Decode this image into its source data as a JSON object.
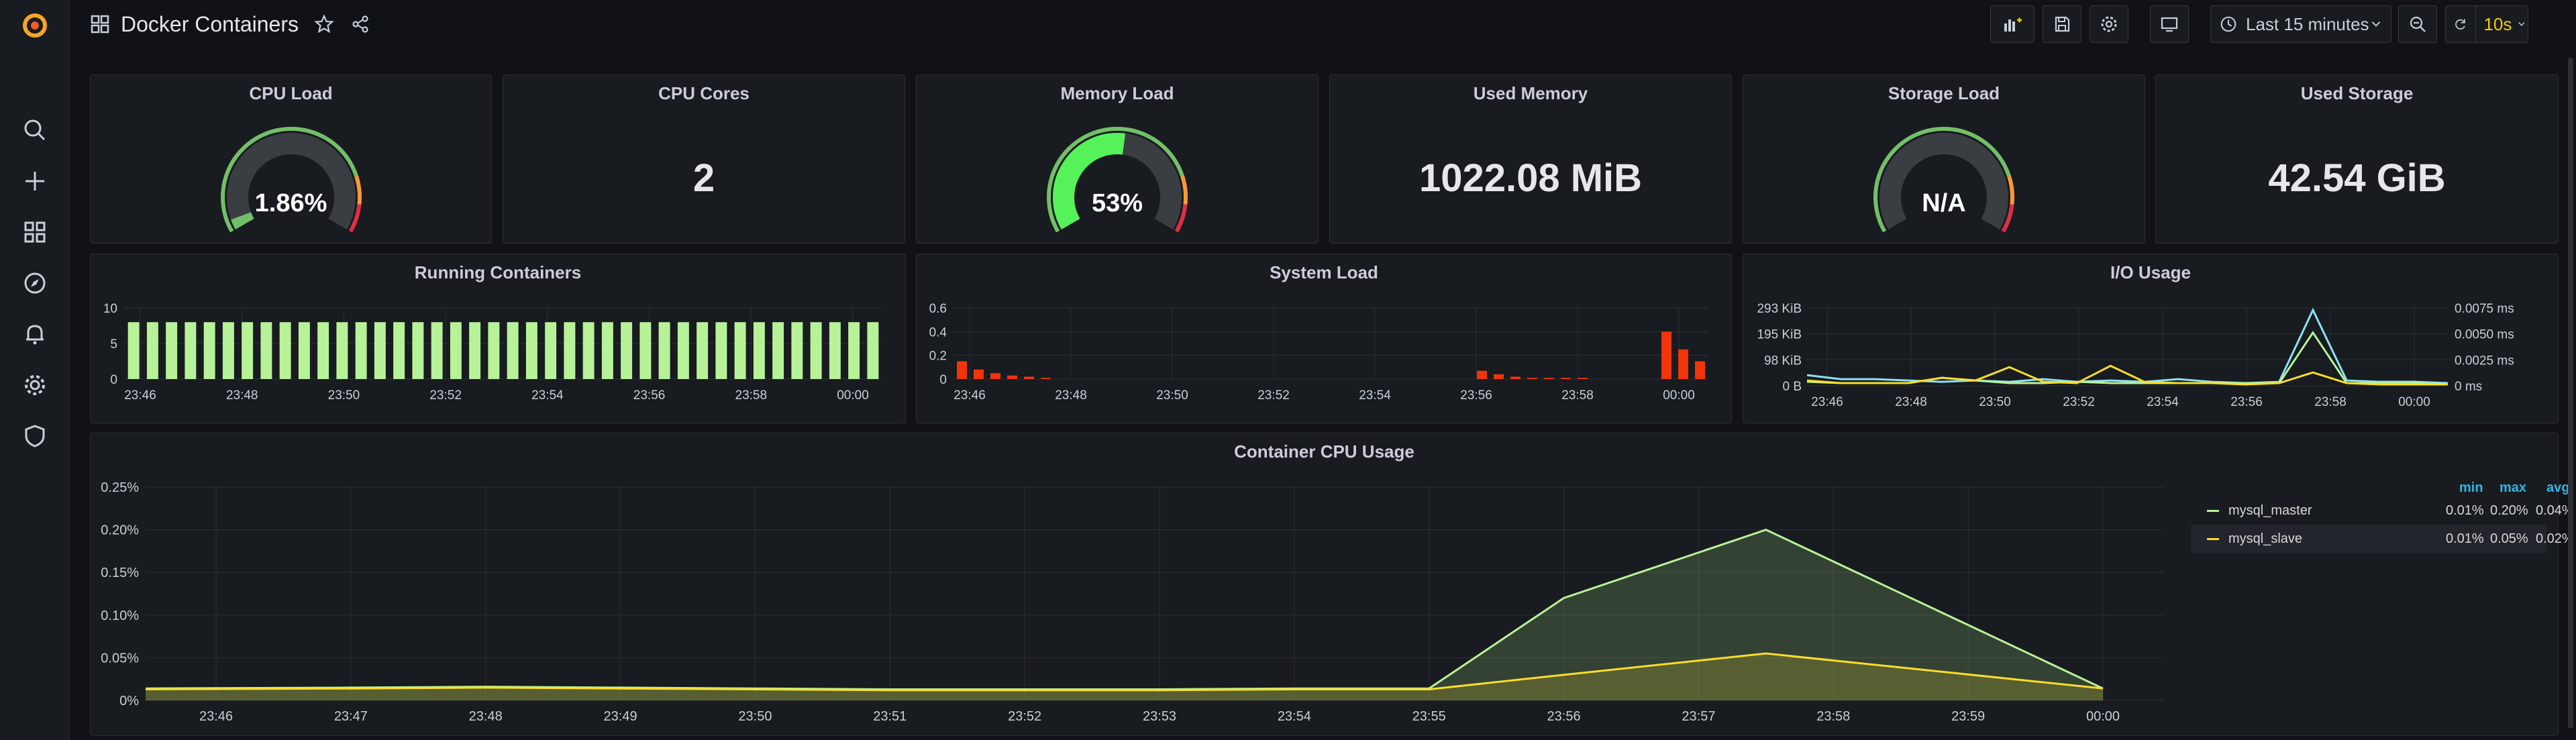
{
  "header": {
    "title": "Docker Containers",
    "time_range": "Last 15 minutes",
    "refresh_interval": "10s"
  },
  "icons": {
    "sidebar": [
      "grafana-logo-icon",
      "search-icon",
      "plus-icon",
      "dashboards-icon",
      "explore-icon",
      "alerting-icon",
      "settings-icon",
      "shield-icon"
    ],
    "toolbar": [
      "add-panel-icon",
      "save-icon",
      "settings-icon",
      "tv-mode-icon",
      "clock-icon",
      "chevron-down-icon",
      "zoom-out-icon",
      "refresh-icon",
      "chevron-down-icon"
    ]
  },
  "colors": {
    "accent": "#f2cc0c",
    "green": "#73bf69",
    "red": "#e02f44",
    "orange": "#ff780a",
    "light_green": "#b7f298",
    "yellow": "#fade2a",
    "cyan": "#8ae2f5"
  },
  "stats": {
    "cpu_load": {
      "title": "CPU Load",
      "value": "1.86%",
      "fraction": 0.0186
    },
    "cpu_cores": {
      "title": "CPU Cores",
      "value": "2"
    },
    "memory_load": {
      "title": "Memory Load",
      "value": "53%",
      "fraction": 0.53
    },
    "used_memory": {
      "title": "Used Memory",
      "value": "1022.08 MiB"
    },
    "storage_load": {
      "title": "Storage Load",
      "value": "N/A",
      "fraction": 0
    },
    "used_storage": {
      "title": "Used Storage",
      "value": "42.54 GiB"
    }
  },
  "chart_data": [
    {
      "id": "running_containers",
      "type": "bar",
      "title": "Running Containers",
      "ylim": [
        0,
        10
      ],
      "yticks": [
        "10",
        "5",
        "0"
      ],
      "xticks": [
        "23:46",
        "23:48",
        "23:50",
        "23:52",
        "23:54",
        "23:56",
        "23:58",
        "00:00"
      ],
      "values": [
        8,
        8,
        8,
        8,
        8,
        8,
        8,
        8,
        8,
        8,
        8,
        8,
        8,
        8,
        8,
        8,
        8,
        8,
        8,
        8,
        8,
        8,
        8,
        8,
        8,
        8,
        8,
        8,
        8,
        8,
        8,
        8,
        8,
        8,
        8,
        8,
        8,
        8,
        8,
        8
      ]
    },
    {
      "id": "system_load",
      "type": "bar",
      "title": "System Load",
      "ylim": [
        0,
        0.6
      ],
      "yticks": [
        "0.6",
        "0.4",
        "0.2",
        "0"
      ],
      "xticks": [
        "23:46",
        "23:48",
        "23:50",
        "23:52",
        "23:54",
        "23:56",
        "23:58",
        "00:00"
      ],
      "values": [
        0.15,
        0.08,
        0.05,
        0.03,
        0.02,
        0.01,
        0,
        0,
        0,
        0,
        0,
        0,
        0,
        0,
        0,
        0,
        0,
        0,
        0,
        0,
        0,
        0,
        0,
        0,
        0,
        0,
        0,
        0,
        0,
        0,
        0,
        0.07,
        0.04,
        0.02,
        0.01,
        0.01,
        0.01,
        0.01,
        0,
        0,
        0,
        0,
        0.4,
        0.25,
        0.15
      ]
    },
    {
      "id": "io_usage",
      "type": "line",
      "title": "I/O Usage",
      "yticks_left": [
        "293 KiB",
        "195 KiB",
        "98 KiB",
        "0 B"
      ],
      "yticks_right": [
        "0.0075 ms",
        "0.0050 ms",
        "0.0025 ms",
        "0 ms"
      ],
      "xticks": [
        "23:46",
        "23:48",
        "23:50",
        "23:52",
        "23:54",
        "23:56",
        "23:58",
        "00:00"
      ],
      "series": [
        {
          "color": "#8ae2f5",
          "values": [
            40,
            25,
            25,
            20,
            15,
            20,
            15,
            25,
            15,
            20,
            15,
            25,
            15,
            10,
            15,
            285,
            20,
            15,
            15,
            10
          ]
        },
        {
          "color": "#b7f298",
          "values": [
            15,
            10,
            10,
            10,
            30,
            20,
            10,
            10,
            15,
            10,
            10,
            10,
            10,
            10,
            10,
            200,
            10,
            10,
            10,
            5
          ]
        },
        {
          "color": "#fade2a",
          "values": [
            20,
            10,
            10,
            10,
            30,
            20,
            70,
            15,
            10,
            75,
            15,
            10,
            10,
            5,
            10,
            50,
            10,
            5,
            5,
            5
          ]
        }
      ]
    },
    {
      "id": "container_cpu_usage",
      "type": "area",
      "title": "Container CPU Usage",
      "ylim": [
        0,
        0.25
      ],
      "yticks": [
        "0.25%",
        "0.20%",
        "0.15%",
        "0.10%",
        "0.05%",
        "0%"
      ],
      "xticks": [
        "23:46",
        "23:47",
        "23:48",
        "23:49",
        "23:50",
        "23:51",
        "23:52",
        "23:53",
        "23:54",
        "23:55",
        "23:56",
        "23:57",
        "23:58",
        "23:59",
        "00:00"
      ],
      "x": [
        0,
        1,
        2,
        3,
        4,
        5,
        6,
        7,
        8,
        9,
        10,
        11.5,
        14
      ],
      "series": [
        {
          "name": "mysql_master",
          "color": "#b7f298",
          "values": [
            0.014,
            0.015,
            0.016,
            0.015,
            0.014,
            0.013,
            0.013,
            0.013,
            0.014,
            0.014,
            0.12,
            0.2,
            0.014
          ]
        },
        {
          "name": "mysql_slave",
          "color": "#fade2a",
          "values": [
            0.013,
            0.014,
            0.015,
            0.014,
            0.013,
            0.012,
            0.012,
            0.012,
            0.013,
            0.013,
            0.03,
            0.055,
            0.014
          ]
        }
      ],
      "legend": {
        "headers": [
          "min",
          "max",
          "avg"
        ],
        "rows": [
          {
            "name": "mysql_master",
            "min": "0.01%",
            "max": "0.20%",
            "avg": "0.04%"
          },
          {
            "name": "mysql_slave",
            "min": "0.01%",
            "max": "0.05%",
            "avg": "0.02%"
          }
        ]
      }
    }
  ]
}
